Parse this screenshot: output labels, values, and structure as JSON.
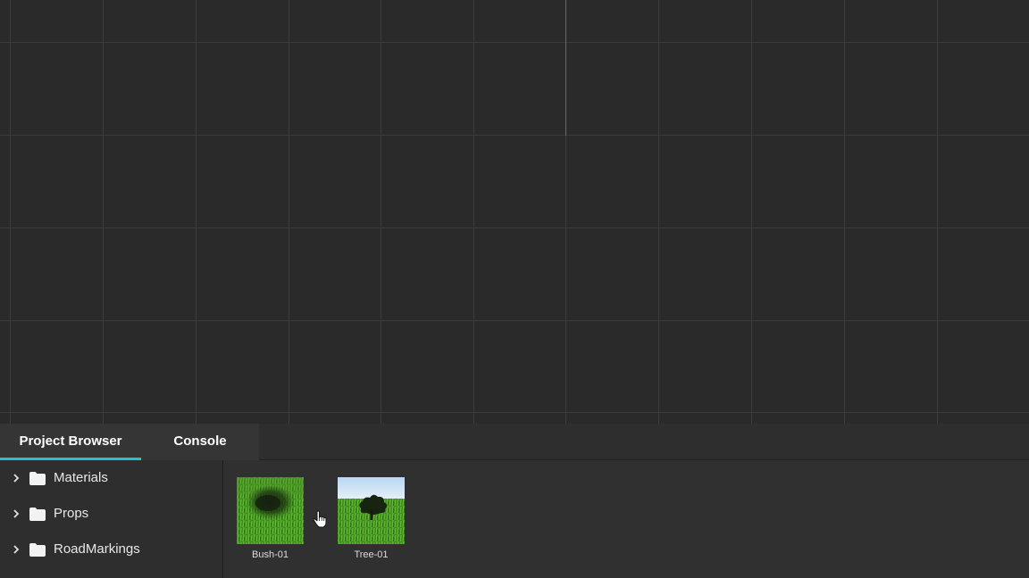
{
  "tabs": [
    {
      "label": "Project Browser",
      "active": true
    },
    {
      "label": "Console",
      "active": false
    }
  ],
  "tree": {
    "items": [
      {
        "label": "Materials",
        "icon": "folder-icon"
      },
      {
        "label": "Props",
        "icon": "folder-icon"
      },
      {
        "label": "RoadMarkings",
        "icon": "folder-icon"
      }
    ]
  },
  "assets": [
    {
      "label": "Bush-01"
    },
    {
      "label": "Tree-01"
    }
  ],
  "colors": {
    "accent": "#27c0cf",
    "viewport_bg": "#2a2a2a",
    "grid": "#3c3c3c",
    "y_axis": "#3f8a2a",
    "x_axis": "#5a2e2a"
  }
}
